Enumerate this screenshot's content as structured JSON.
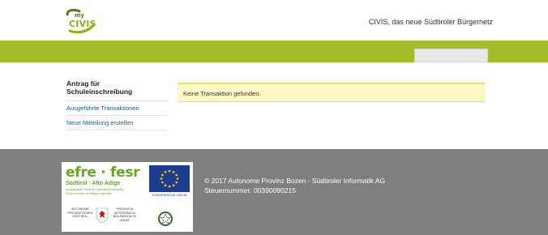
{
  "header": {
    "logo_my": "my",
    "logo_civis": "CIVIS",
    "tagline": "CIVIS, das neue Südtiroler Bürgernetz"
  },
  "sidebar": {
    "title": "Antrag für Schuleinschreibung",
    "links": [
      {
        "label": "Ausgeführte Transaktionen"
      },
      {
        "label": "Neue Mitteilung erstellen"
      }
    ]
  },
  "main": {
    "notice": "Keine Transaktion gefunden."
  },
  "footer": {
    "efre_logo": "efre · fesr",
    "efre_region": "Südtirol · Alto Adige",
    "efre_small_de": "Europäischer Fonds für regionale Entwicklung",
    "efre_small_it": "Fondo europeo di sviluppo regionale",
    "eu_caption": "EUROPÄISCHE UNION",
    "prov_left": "AUTONOME PROVINZ BOZEN SÜDTIROL",
    "prov_right": "PROVINCIA AUTONOMA DI BOLZANO ALTO ADIGE",
    "copyright": "© 2017 Autonome Provinz Bozen - Südtiroler Informatik AG",
    "tax_number": "Steuernummer: 00390090215"
  },
  "colors": {
    "green_bar": "#a3bd2b",
    "footer_bg": "#7f7f7f",
    "notice_bg": "#fff8c4",
    "link": "#1d5a9e"
  }
}
